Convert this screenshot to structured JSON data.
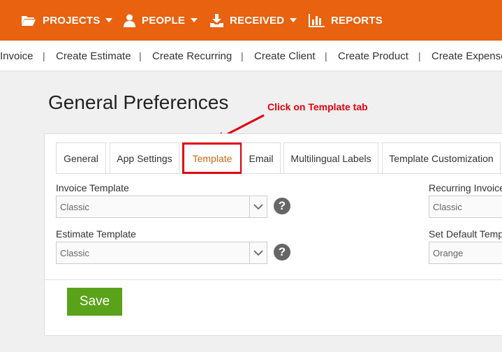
{
  "top_nav": [
    {
      "label": "PROJECTS",
      "icon": "folder-open-icon"
    },
    {
      "label": "PEOPLE",
      "icon": "user-icon"
    },
    {
      "label": "RECEIVED",
      "icon": "download-tray-icon"
    },
    {
      "label": "REPORTS",
      "icon": "bar-chart-icon"
    }
  ],
  "sub_nav": [
    "Invoice",
    "Create Estimate",
    "Create Recurring",
    "Create Client",
    "Create Product",
    "Create Expense"
  ],
  "sub_nav_separator": "|",
  "page_title": "General Preferences",
  "annotation": "Click on Template tab",
  "tabs": [
    "General",
    "App Settings",
    "Template",
    "Email",
    "Multilingual Labels",
    "Template Customization"
  ],
  "active_tab": "Template",
  "fields": {
    "invoice_template": {
      "label": "Invoice Template",
      "value": "Classic"
    },
    "estimate_template": {
      "label": "Estimate Template",
      "value": "Classic"
    },
    "recurring_invoice": {
      "label": "Recurring Invoice",
      "value": "Classic"
    },
    "set_default_template": {
      "label": "Set Default Temp",
      "value": "Orange"
    }
  },
  "help_glyph": "?",
  "save_label": "Save",
  "colors": {
    "brand_orange": "#e8620f",
    "save_green": "#5aa21a",
    "annotation_red": "#e3000f",
    "active_tab_text": "#c86c17"
  }
}
